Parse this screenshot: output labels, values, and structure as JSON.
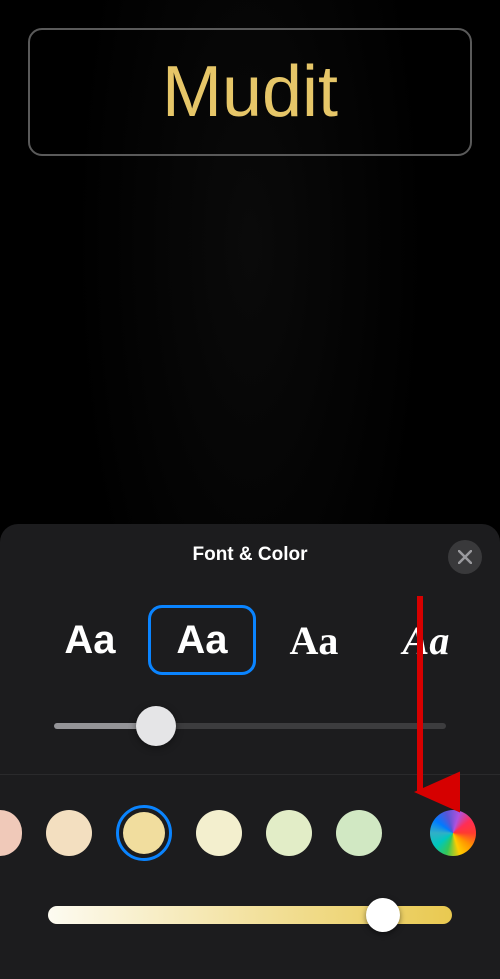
{
  "title_text": "Mudit",
  "panel": {
    "title": "Font & Color",
    "fonts": {
      "sample_glyph": "Aa",
      "selected_index": 1
    },
    "weight_slider": {
      "value_percent": 26
    },
    "color_swatches": [
      {
        "hex": "#f0c9b9",
        "partial": true
      },
      {
        "hex": "#f3dfc0"
      },
      {
        "hex": "#f1dd9e",
        "selected": true
      },
      {
        "hex": "#f3efce"
      },
      {
        "hex": "#e2edc7"
      },
      {
        "hex": "#d1e8c3"
      }
    ],
    "custom_color_label": "custom-color-picker",
    "color_intensity_slider": {
      "value_percent": 83,
      "gradient_start": "#fdfbf1",
      "gradient_end": "#e9c950"
    }
  },
  "colors": {
    "text_accent": "#e6c668",
    "selection": "#0a84ff"
  }
}
